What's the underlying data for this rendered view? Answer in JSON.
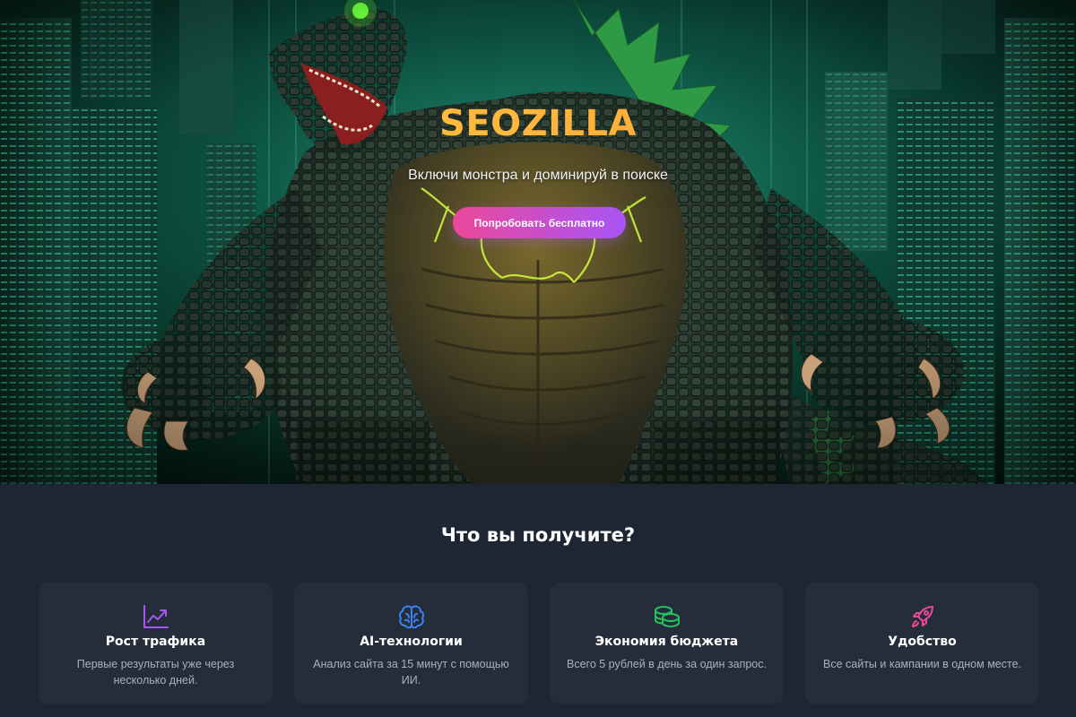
{
  "hero": {
    "title": "SEOZILLA",
    "subtitle": "Включи монстра и доминируй в поиске",
    "cta_label": "Попробовать бесплатно"
  },
  "features": {
    "heading": "Что вы получите?",
    "items": [
      {
        "icon": "chart-trending-up-icon",
        "color": "#a855f7",
        "title": "Рост трафика",
        "text": "Первые результаты уже через несколько дней."
      },
      {
        "icon": "brain-icon",
        "color": "#3b82f6",
        "title": "AI-технологии",
        "text": "Анализ сайта за 15 минут с помощью ИИ."
      },
      {
        "icon": "coins-icon",
        "color": "#22c55e",
        "title": "Экономия бюджета",
        "text": "Всего 5 рублей в день за один запрос."
      },
      {
        "icon": "rocket-icon",
        "color": "#ec4899",
        "title": "Удобство",
        "text": "Все сайты и кампании в одном месте."
      }
    ]
  },
  "colors": {
    "title_gradient_start": "#ffd54a",
    "title_gradient_end": "#ff8a3d",
    "cta_gradient_start": "#ec4899",
    "cta_gradient_end": "#a855f7",
    "features_background": "#1e2533",
    "card_background": "#252d3b"
  }
}
